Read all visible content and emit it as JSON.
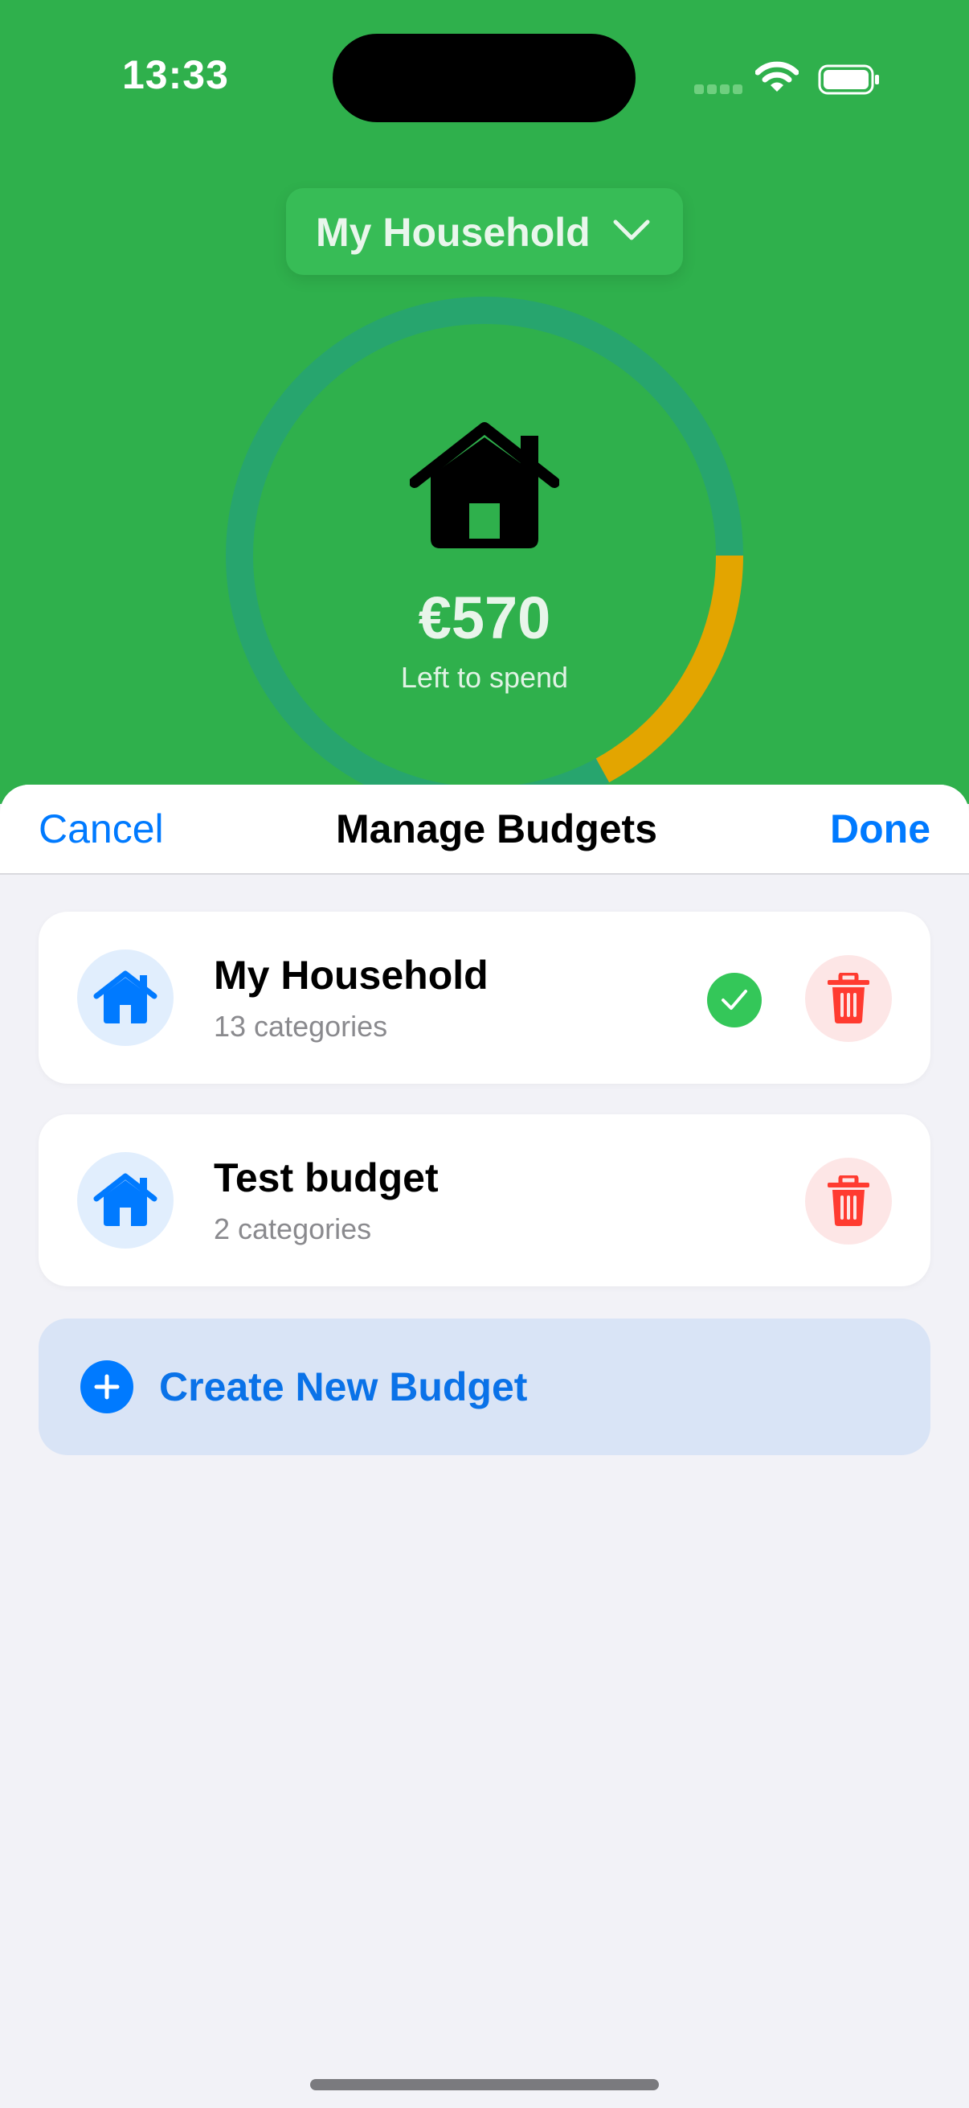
{
  "status_bar": {
    "time": "13:33"
  },
  "header": {
    "household_selector": "My Household",
    "amount": "€570",
    "amount_caption": "Left to spend",
    "spent_fraction": 0.17,
    "colors": {
      "background": "#2FB04C",
      "ring_track": "#27A56E",
      "ring_progress": "#E3A500"
    }
  },
  "sheet": {
    "cancel_label": "Cancel",
    "title": "Manage Budgets",
    "done_label": "Done",
    "budgets": [
      {
        "name": "My Household",
        "count": "13 categories",
        "selected": true,
        "icon": "house-icon"
      },
      {
        "name": "Test budget",
        "count": "2 categories",
        "selected": false,
        "icon": "house-icon"
      }
    ],
    "create_label": "Create New Budget"
  }
}
